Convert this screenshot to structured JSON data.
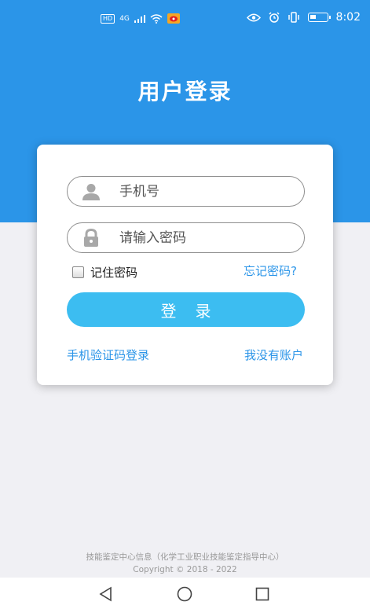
{
  "status_bar": {
    "hd_badge": "HD",
    "network": "4G",
    "time": "8:02",
    "battery_level": 0.35
  },
  "header": {
    "title": "用户登录"
  },
  "form": {
    "phone_placeholder": "手机号",
    "password_placeholder": "请输入密码",
    "remember_label": "记住密码",
    "remember_checked": false,
    "forgot_label": "忘记密码?",
    "login_label": "登录",
    "sms_login_label": "手机验证码登录",
    "register_label": "我没有账户"
  },
  "footer": {
    "org": "技能鉴定中心信息（化学工业职业技能鉴定指导中心）",
    "copyright": "Copyright © 2018 - 2022"
  },
  "colors": {
    "header_blue": "#2b95e8",
    "button_blue": "#3cbdf1",
    "link_blue": "#2b95e8"
  },
  "icons": {
    "phone_field": "user-icon",
    "password_field": "lock-icon",
    "nav_back": "back-triangle-icon",
    "nav_home": "home-circle-icon",
    "nav_recent": "recent-square-icon"
  }
}
